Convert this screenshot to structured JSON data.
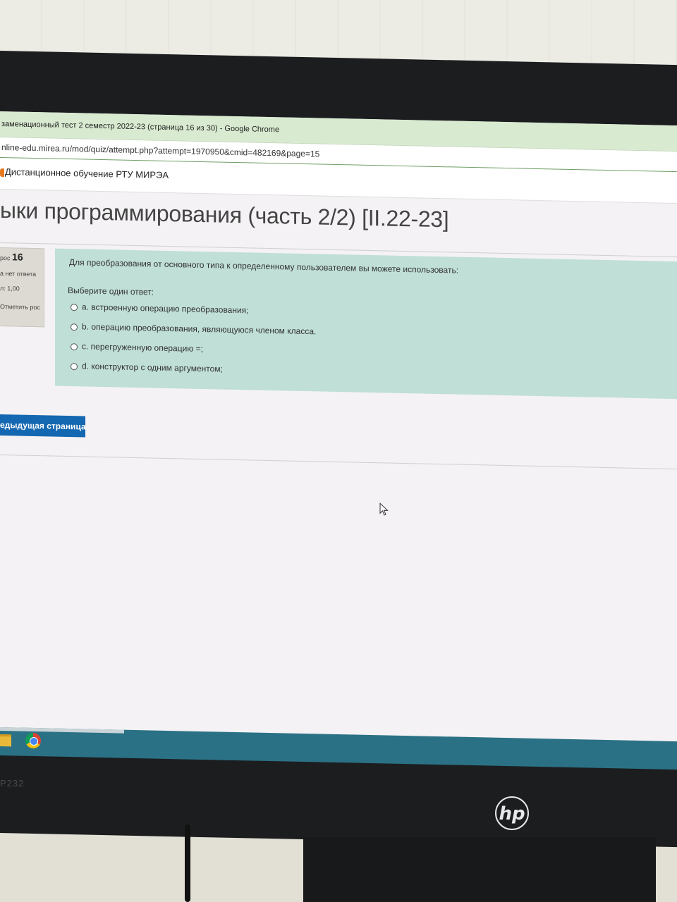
{
  "window": {
    "title": "заменационный тест 2 семестр 2022-23 (страница 16 из 30) - Google Chrome",
    "url": "nline-edu.mirea.ru/mod/quiz/attempt.php?attempt=1970950&cmid=482169&page=15"
  },
  "site": {
    "name": "Дистанционное обучение РТУ МИРЭА"
  },
  "course": {
    "title": "ыки программирования (часть 2/2) [II.22-23]"
  },
  "question": {
    "number_label": "рос",
    "number": "16",
    "state": "а нет ответа",
    "grade": "л: 1,00",
    "flag_label": "Отметить рос",
    "text": "Для преобразования от основного типа к определенному пользователем вы можете использовать:",
    "prompt": "Выберите один ответ:",
    "answers": [
      {
        "label": "a. встроенную операцию преобразования;",
        "selected": false
      },
      {
        "label": "b. операцию преобразования, являющуюся членом класса.",
        "selected": false
      },
      {
        "label": "c. перегруженную операцию =;",
        "selected": false
      },
      {
        "label": "d. конструктор с одним аргументом;",
        "selected": false
      }
    ]
  },
  "navigation": {
    "prev_label": "едыдущая страница"
  },
  "taskbar": {
    "items": [
      "file-explorer-icon",
      "chrome-icon"
    ]
  },
  "monitor": {
    "model": "P232",
    "brand": "hp"
  },
  "colors": {
    "question_bg": "#c0dfd6",
    "button_blue": "#1467b1",
    "title_bar": "#d8ead0",
    "taskbar": "#2b7185"
  }
}
